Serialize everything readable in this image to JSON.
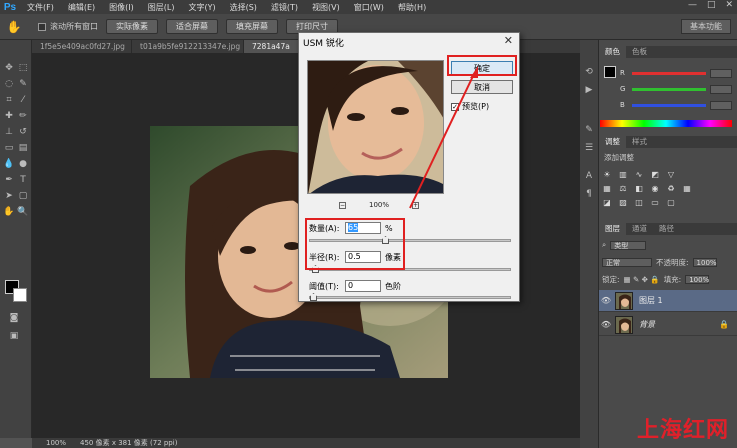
{
  "menubar": {
    "logo": "Ps",
    "items": [
      "文件(F)",
      "编辑(E)",
      "图像(I)",
      "图层(L)",
      "文字(Y)",
      "选择(S)",
      "滤镜(T)",
      "视图(V)",
      "窗口(W)",
      "帮助(H)"
    ],
    "window_controls": [
      "—",
      "□",
      "✕"
    ]
  },
  "options_bar": {
    "scroll_all": "滚动所有窗口",
    "buttons": [
      "实际像素",
      "适合屏幕",
      "填充屏幕",
      "打印尺寸"
    ],
    "workspace": "基本功能"
  },
  "tabs": [
    "1f5e5e409ac0fd27.jpg",
    "t01a9b5fe912213347e.jpg",
    "7281a47a"
  ],
  "status": {
    "zoom": "100%",
    "doc_info": "450 像素 x 381 像素 (72 ppi)"
  },
  "color_panel": {
    "tabs": [
      "颜色",
      "色板"
    ],
    "channels": [
      {
        "label": "R",
        "color": "#e03030"
      },
      {
        "label": "G",
        "color": "#30c030"
      },
      {
        "label": "B",
        "color": "#3050e0"
      }
    ]
  },
  "adjust_panel": {
    "tabs": [
      "调整",
      "样式"
    ],
    "heading": "添加调整"
  },
  "layers_panel": {
    "tabs": [
      "图层",
      "通道",
      "路径"
    ],
    "kind": "类型",
    "blend_mode": "正常",
    "opacity_label": "不透明度:",
    "opacity": "100%",
    "lock_label": "锁定:",
    "fill_label": "填充:",
    "fill": "100%",
    "layers": [
      {
        "name": "图层 1",
        "selected": true
      },
      {
        "name": "背景",
        "selected": false
      }
    ]
  },
  "dialog": {
    "title": "USM 锐化",
    "ok": "确定",
    "cancel": "取消",
    "preview": "预览(P)",
    "zoom": "100%",
    "params": [
      {
        "label": "数量(A):",
        "value": "65",
        "unit": "%"
      },
      {
        "label": "半径(R):",
        "value": "0.5",
        "unit": "像素"
      },
      {
        "label": "阈值(T):",
        "value": "0",
        "unit": "色阶"
      }
    ]
  },
  "watermark": "上海红网"
}
